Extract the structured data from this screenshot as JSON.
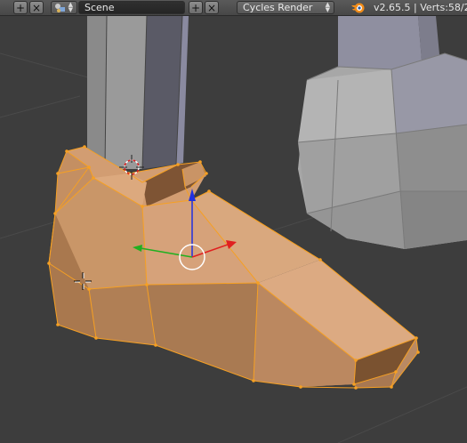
{
  "header": {
    "add_label": "+",
    "close_label": "×",
    "scene": {
      "name": "Scene"
    },
    "render_engine": {
      "selected": "Cycles Render"
    },
    "info": {
      "version": "v2.65.5",
      "verts": "Verts:58/2"
    }
  },
  "viewport": {
    "background_color": "#3d3d3d",
    "selected_mesh_color": "#d9a272",
    "edge_select_color": "#f6a023",
    "unselected_mesh_color": "#9c9c9c",
    "axis_colors": {
      "x": "#e02020",
      "y": "#20b020",
      "z": "#2030e0"
    }
  }
}
